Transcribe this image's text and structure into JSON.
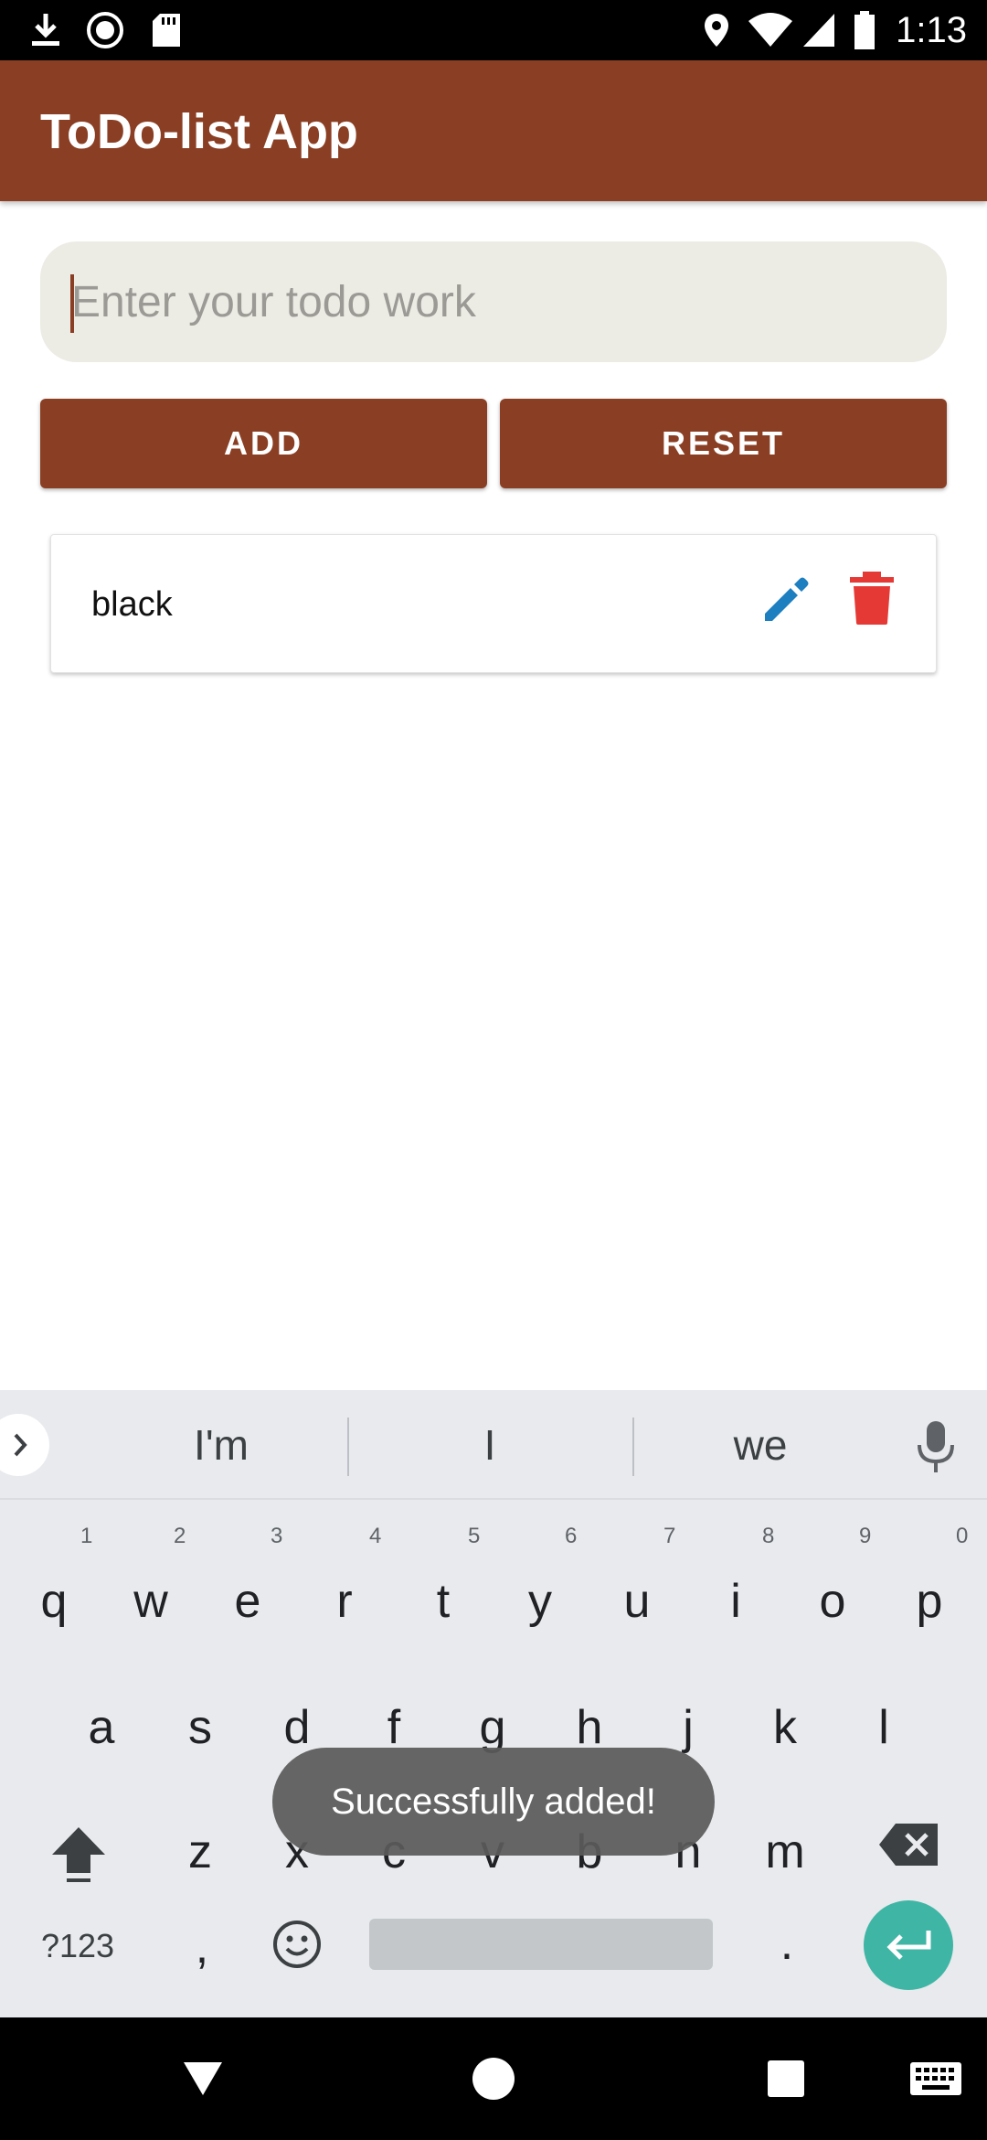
{
  "status_bar": {
    "time": "1:13",
    "icons": [
      "download-icon",
      "record-icon",
      "sd-card-icon",
      "location-icon",
      "wifi-icon",
      "signal-icon",
      "battery-icon"
    ]
  },
  "app_bar": {
    "title": "ToDo-list App",
    "color": "#8a3f24"
  },
  "todo_input": {
    "placeholder": "Enter your todo work",
    "value": ""
  },
  "buttons": {
    "add_label": "ADD",
    "reset_label": "RESET"
  },
  "todos": [
    {
      "text": "black",
      "edit_icon": "pencil-icon",
      "delete_icon": "trash-icon"
    }
  ],
  "keyboard": {
    "suggestions": [
      "I'm",
      "I",
      "we"
    ],
    "row1": [
      "q",
      "w",
      "e",
      "r",
      "t",
      "y",
      "u",
      "i",
      "o",
      "p"
    ],
    "row1_numbers": [
      "1",
      "2",
      "3",
      "4",
      "5",
      "6",
      "7",
      "8",
      "9",
      "0"
    ],
    "row2": [
      "a",
      "s",
      "d",
      "f",
      "g",
      "h",
      "j",
      "k",
      "l"
    ],
    "row3": [
      "z",
      "x",
      "c",
      "v",
      "b",
      "n",
      "m"
    ],
    "symbols_label": "?123",
    "comma": ",",
    "period": "."
  },
  "toast": {
    "message": "Successfully added!"
  },
  "colors": {
    "delete": "#e53935",
    "edit": "#1e7fc0",
    "enter": "#3fb5a5"
  }
}
